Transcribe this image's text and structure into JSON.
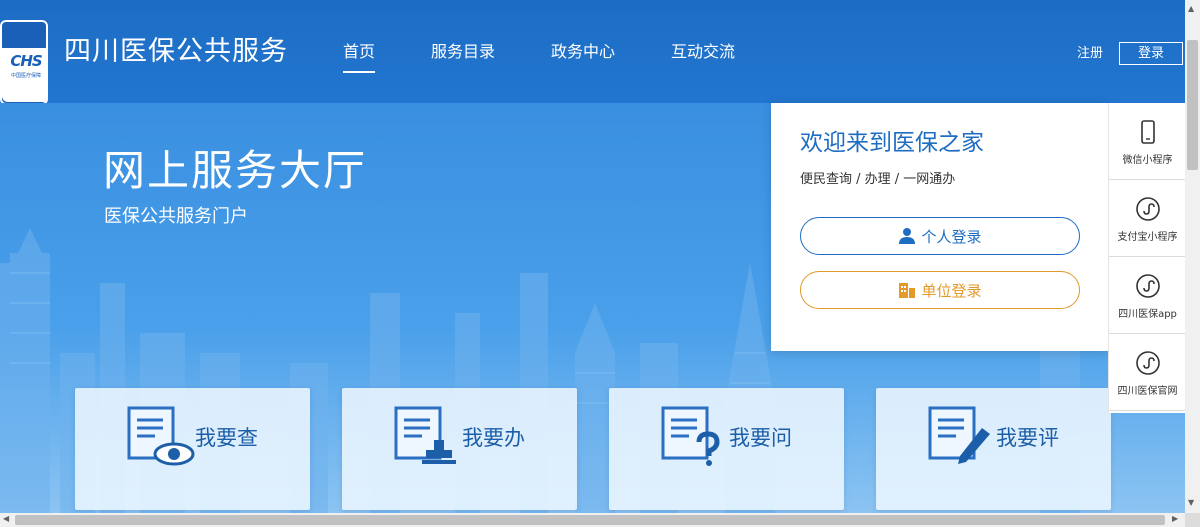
{
  "header": {
    "logo_text": "CHS",
    "logo_subtext": "中国医疗保障",
    "site_title": "四川医保公共服务",
    "nav": [
      {
        "label": "首页",
        "active": true
      },
      {
        "label": "服务目录",
        "active": false
      },
      {
        "label": "政务中心",
        "active": false
      },
      {
        "label": "互动交流",
        "active": false
      }
    ],
    "register_label": "注册",
    "login_label": "登录"
  },
  "hero": {
    "title": "网上服务大厅",
    "subtitle": "医保公共服务门户"
  },
  "cards": [
    {
      "label": "我要查",
      "icon": "document-eye-icon"
    },
    {
      "label": "我要办",
      "icon": "document-stamp-icon"
    },
    {
      "label": "我要问",
      "icon": "document-question-icon"
    },
    {
      "label": "我要评",
      "icon": "document-pen-icon"
    }
  ],
  "login_panel": {
    "welcome": "欢迎来到医保之家",
    "tagline": "便民查询 / 办理 / 一网通办",
    "personal_login": "个人登录",
    "unit_login": "单位登录"
  },
  "side_rail": [
    {
      "label": "微信小程序",
      "icon": "phone-icon"
    },
    {
      "label": "支付宝小程序",
      "icon": "mini-program-icon"
    },
    {
      "label": "四川医保app",
      "icon": "mini-program-icon"
    },
    {
      "label": "四川医保官网",
      "icon": "mini-program-icon"
    }
  ],
  "colors": {
    "brand_blue": "#1f6dc2",
    "accent_orange": "#e39a2a"
  }
}
